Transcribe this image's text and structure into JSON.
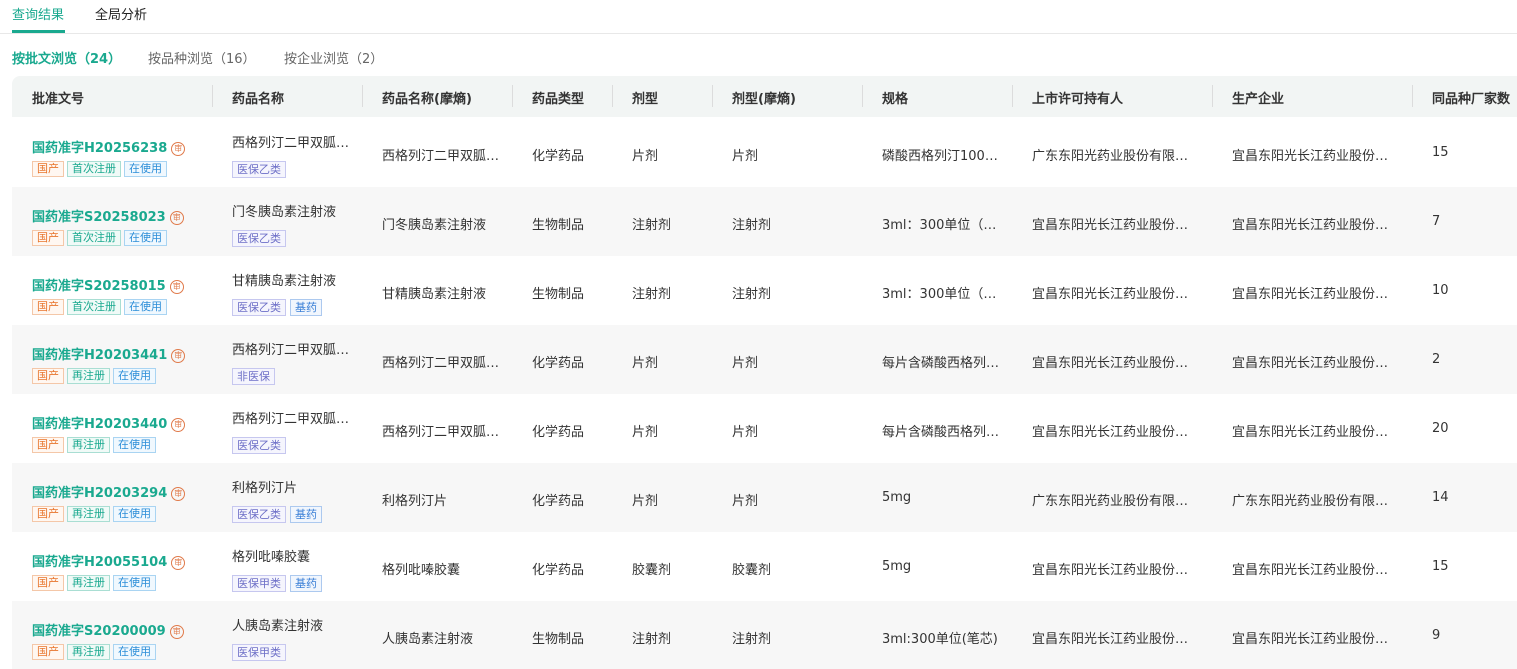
{
  "top_tabs": [
    "查询结果",
    "全局分析"
  ],
  "sub_tabs": [
    "按批文浏览（24）",
    "按品种浏览（16）",
    "按企业浏览（2）"
  ],
  "columns": [
    "批准文号",
    "药品名称",
    "药品名称(摩熵)",
    "药品类型",
    "剂型",
    "剂型(摩熵)",
    "规格",
    "上市许可持有人",
    "生产企业",
    "同品种厂家数"
  ],
  "seal_char": "审",
  "rows": [
    {
      "approval": "国药准字H20256238",
      "tags": [
        "国产",
        "首次注册",
        "在使用"
      ],
      "name": "西格列汀二甲双胍…",
      "name_tags": [
        "医保乙类"
      ],
      "name_ms": "西格列汀二甲双胍…",
      "type": "化学药品",
      "form": "片剂",
      "form_ms": "片剂",
      "spec": "磷酸西格列汀100…",
      "holder": "广东东阳光药业股份有限…",
      "maker": "宜昌东阳光长江药业股份…",
      "count": "15"
    },
    {
      "approval": "国药准字S20258023",
      "tags": [
        "国产",
        "首次注册",
        "在使用"
      ],
      "name": "门冬胰岛素注射液",
      "name_tags": [
        "医保乙类"
      ],
      "name_ms": "门冬胰岛素注射液",
      "type": "生物制品",
      "form": "注射剂",
      "form_ms": "注射剂",
      "spec": "3ml：300单位（…",
      "holder": "宜昌东阳光长江药业股份…",
      "maker": "宜昌东阳光长江药业股份…",
      "count": "7"
    },
    {
      "approval": "国药准字S20258015",
      "tags": [
        "国产",
        "首次注册",
        "在使用"
      ],
      "name": "甘精胰岛素注射液",
      "name_tags": [
        "医保乙类",
        "基药"
      ],
      "name_ms": "甘精胰岛素注射液",
      "type": "生物制品",
      "form": "注射剂",
      "form_ms": "注射剂",
      "spec": "3ml：300单位（…",
      "holder": "宜昌东阳光长江药业股份…",
      "maker": "宜昌东阳光长江药业股份…",
      "count": "10"
    },
    {
      "approval": "国药准字H20203441",
      "tags": [
        "国产",
        "再注册",
        "在使用"
      ],
      "name": "西格列汀二甲双胍…",
      "name_tags": [
        "非医保"
      ],
      "name_ms": "西格列汀二甲双胍…",
      "type": "化学药品",
      "form": "片剂",
      "form_ms": "片剂",
      "spec": "每片含磷酸西格列…",
      "holder": "宜昌东阳光长江药业股份…",
      "maker": "宜昌东阳光长江药业股份…",
      "count": "2"
    },
    {
      "approval": "国药准字H20203440",
      "tags": [
        "国产",
        "再注册",
        "在使用"
      ],
      "name": "西格列汀二甲双胍…",
      "name_tags": [
        "医保乙类"
      ],
      "name_ms": "西格列汀二甲双胍…",
      "type": "化学药品",
      "form": "片剂",
      "form_ms": "片剂",
      "spec": "每片含磷酸西格列…",
      "holder": "宜昌东阳光长江药业股份…",
      "maker": "宜昌东阳光长江药业股份…",
      "count": "20"
    },
    {
      "approval": "国药准字H20203294",
      "tags": [
        "国产",
        "再注册",
        "在使用"
      ],
      "name": "利格列汀片",
      "name_tags": [
        "医保乙类",
        "基药"
      ],
      "name_ms": "利格列汀片",
      "type": "化学药品",
      "form": "片剂",
      "form_ms": "片剂",
      "spec": "5mg",
      "holder": "广东东阳光药业股份有限…",
      "maker": "广东东阳光药业股份有限…",
      "count": "14"
    },
    {
      "approval": "国药准字H20055104",
      "tags": [
        "国产",
        "再注册",
        "在使用"
      ],
      "name": "格列吡嗪胶囊",
      "name_tags": [
        "医保甲类",
        "基药"
      ],
      "name_ms": "格列吡嗪胶囊",
      "type": "化学药品",
      "form": "胶囊剂",
      "form_ms": "胶囊剂",
      "spec": "5mg",
      "holder": "宜昌东阳光长江药业股份…",
      "maker": "宜昌东阳光长江药业股份…",
      "count": "15"
    },
    {
      "approval": "国药准字S20200009",
      "tags": [
        "国产",
        "再注册",
        "在使用"
      ],
      "name": "人胰岛素注射液",
      "name_tags": [
        "医保甲类"
      ],
      "name_ms": "人胰岛素注射液",
      "type": "生物制品",
      "form": "注射剂",
      "form_ms": "注射剂",
      "spec": "3ml:300单位(笔芯)",
      "holder": "宜昌东阳光长江药业股份…",
      "maker": "宜昌东阳光长江药业股份…",
      "count": "9"
    }
  ]
}
